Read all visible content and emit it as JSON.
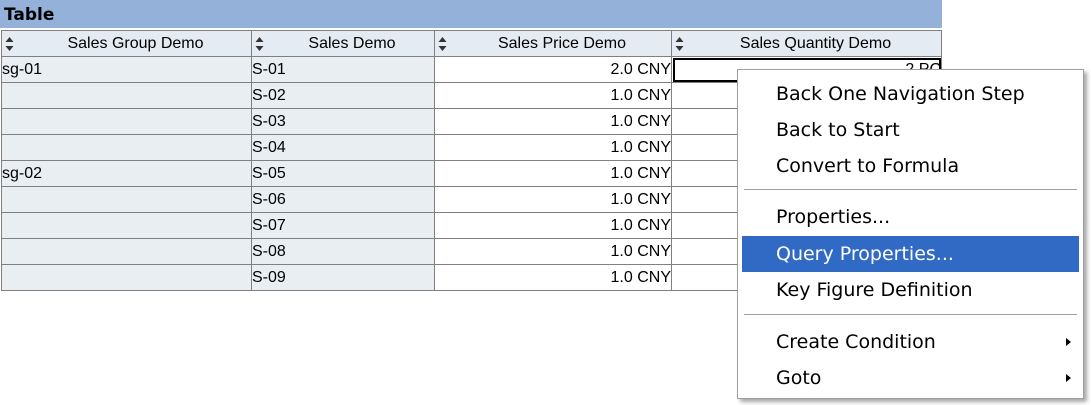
{
  "title": "Table",
  "columns": [
    {
      "label": "Sales Group Demo"
    },
    {
      "label": "Sales Demo"
    },
    {
      "label": "Sales Price Demo"
    },
    {
      "label": "Sales Quantity Demo"
    }
  ],
  "rows": [
    {
      "group": "sg-01",
      "sales": "S-01",
      "price": "2.0 CNY",
      "qty": "2 PC"
    },
    {
      "group": "",
      "sales": "S-02",
      "price": "1.0 CNY",
      "qty": ""
    },
    {
      "group": "",
      "sales": "S-03",
      "price": "1.0 CNY",
      "qty": ""
    },
    {
      "group": "",
      "sales": "S-04",
      "price": "1.0 CNY",
      "qty": ""
    },
    {
      "group": "sg-02",
      "sales": "S-05",
      "price": "1.0 CNY",
      "qty": ""
    },
    {
      "group": "",
      "sales": "S-06",
      "price": "1.0 CNY",
      "qty": ""
    },
    {
      "group": "",
      "sales": "S-07",
      "price": "1.0 CNY",
      "qty": ""
    },
    {
      "group": "",
      "sales": "S-08",
      "price": "1.0 CNY",
      "qty": ""
    },
    {
      "group": "",
      "sales": "S-09",
      "price": "1.0 CNY",
      "qty": ""
    }
  ],
  "context_menu": {
    "back_one_step": "Back One Navigation Step",
    "back_to_start": "Back to Start",
    "convert_formula": "Convert to Formula",
    "properties": "Properties...",
    "query_properties": "Query Properties...",
    "key_figure_def": "Key Figure Definition",
    "create_condition": "Create Condition",
    "goto": "Goto"
  },
  "colors": {
    "title_bar": "#93b1d9",
    "header_bg": "#e4ebf2",
    "menu_highlight": "#316ac5"
  }
}
